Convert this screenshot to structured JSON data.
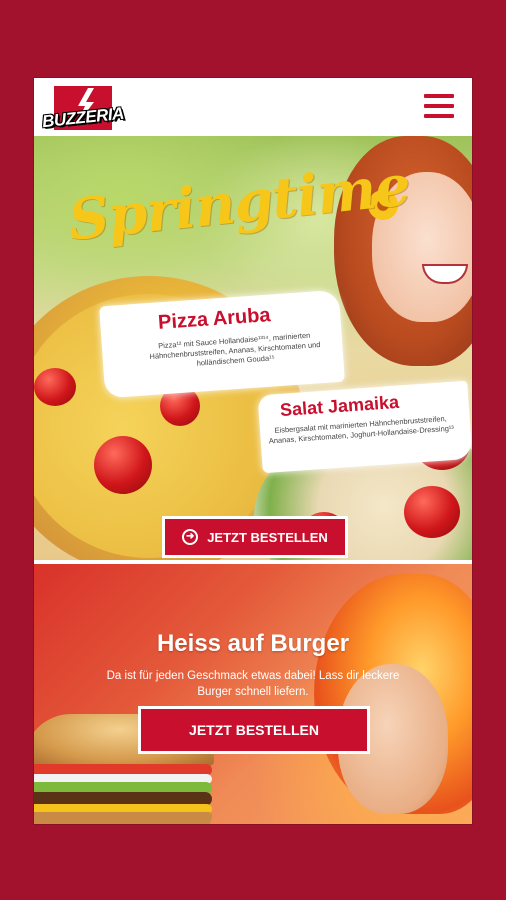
{
  "header": {
    "logo_text": "BUZZERIA",
    "menu_icon": "hamburger-menu-icon"
  },
  "spring_banner": {
    "title": "Springtime",
    "pizza_name": "Pizza Aruba",
    "pizza_desc": "Pizza¹² mit Sauce Hollandaise¹³¹⁴, marinierten Hähnchenbruststreifen, Ananas, Kirschtomaten und holländischem Gouda¹⁵",
    "salad_name": "Salat Jamaika",
    "salad_desc": "Eisbergsalat mit marinierten Hähnchenbruststreifen, Ananas, Kirschtomaten, Joghurt-Hollandaise-Dressing¹³",
    "button_label": "JETZT BESTELLEN",
    "button_icon": "arrow-right-circle-icon"
  },
  "burger_banner": {
    "title": "Heiss auf Burger",
    "desc_line1": "Da ist für jeden Geschmack etwas dabei! Lass dir leckere",
    "desc_line2": "Burger schnell liefern.",
    "button_label": "JETZT BESTELLEN"
  },
  "colors": {
    "brand_red": "#c8102e",
    "background": "#a3122c",
    "title_yellow": "#f6c619"
  }
}
